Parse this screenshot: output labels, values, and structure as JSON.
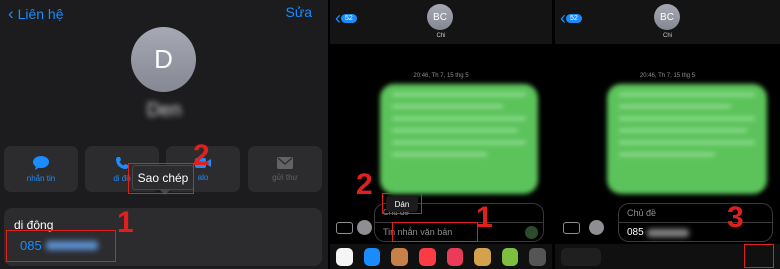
{
  "p1": {
    "back_label": "Liên hệ",
    "edit_label": "Sửa",
    "avatar_letter": "D",
    "contact_name": "Den",
    "actions": [
      {
        "label": "nhắn tin",
        "icon": "message-icon"
      },
      {
        "label": "di độ",
        "icon": "phone-icon"
      },
      {
        "label": "alo",
        "icon": "video-icon"
      },
      {
        "label": "gửi thư",
        "icon": "mail-icon"
      }
    ],
    "popup_label": "Sao chép",
    "phone_type": "di động",
    "phone_prefix": "085",
    "step_1": "1",
    "step_2": "2"
  },
  "p2": {
    "back_badge": "52",
    "avatar_initials": "BC",
    "contact_name": "Chi",
    "timestamp": "20:46, Th 7, 15 thg 5",
    "paste_label": "Dán",
    "subject_placeholder": "Chủ đề",
    "message_placeholder": "Tin nhắn văn bản",
    "step_1": "1",
    "step_2": "2"
  },
  "p3": {
    "back_badge": "52",
    "avatar_initials": "BC",
    "contact_name": "Chi",
    "timestamp": "20:46, Th 7, 15 thg 5",
    "subject_placeholder": "Chủ đề",
    "message_value": "085",
    "step_3": "3"
  },
  "colors": {
    "ios_blue": "#1a8cff",
    "annotation_red": "#e0201c",
    "bubble_green": "#5cc35b",
    "send_green": "#34c759"
  }
}
